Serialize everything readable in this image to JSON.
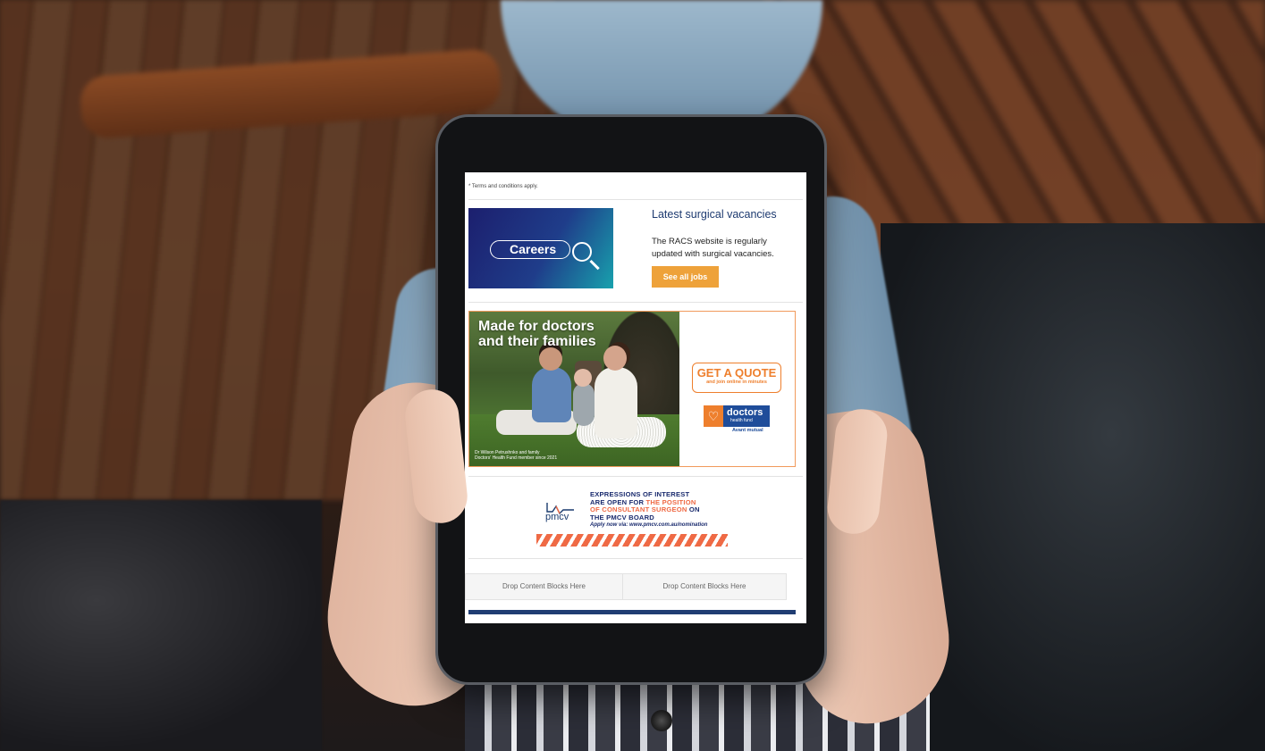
{
  "email": {
    "terms": "* Terms and conditions apply.",
    "careers": {
      "image_label": "Careers",
      "title": "Latest surgical vacancies",
      "body": "The RACS website is regularly updated with surgical vacancies.",
      "button": "See all jobs"
    },
    "insurance_ad": {
      "headline_line1": "Made for doctors",
      "headline_line2": "and their families",
      "caption_line1": "Dr Wilson Petrushnko and family",
      "caption_line2": "Doctors' Health Fund member since 2021",
      "quote_main": "GET A QUOTE",
      "quote_sub": "and join online in minutes",
      "brand_word": "doctors",
      "brand_sub": "health fund",
      "brand_parent": "Avant mutual"
    },
    "pmcv_ad": {
      "logo_word": "pmcv",
      "line1": "EXPRESSIONS OF INTEREST",
      "line2_a": "ARE OPEN FOR ",
      "line2_b": "THE POSITION",
      "line3_a": "OF CONSULTANT SURGEON",
      "line3_b": " ON",
      "line4": "THE PMCV BOARD",
      "apply": "Apply now via: www.pmcv.com.au/nomination"
    },
    "drop_zones": [
      "Drop Content Blocks Here",
      "Drop Content Blocks Here"
    ]
  },
  "colors": {
    "heading": "#1d3a70",
    "button": "#eea23a",
    "accent_orange": "#ee7f2d",
    "footer_bar": "#203d72"
  }
}
